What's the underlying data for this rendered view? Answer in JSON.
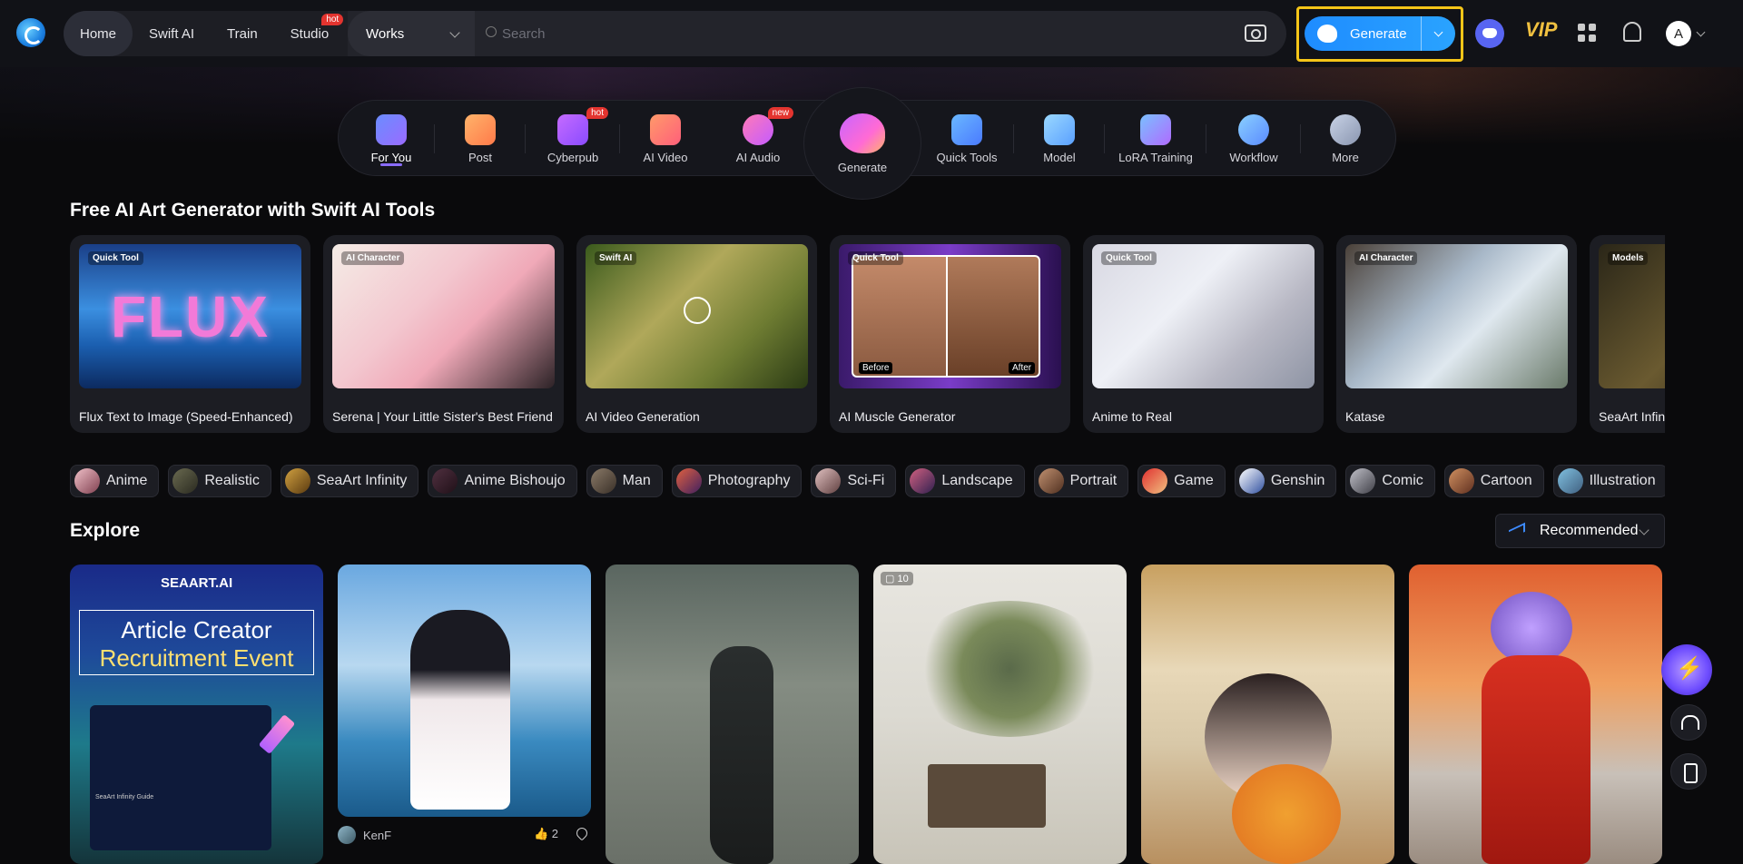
{
  "nav": {
    "items": [
      "Home",
      "Swift AI",
      "Train",
      "Studio"
    ],
    "studio_badge": "hot"
  },
  "search": {
    "scope": "Works",
    "placeholder": "Search"
  },
  "generate": {
    "label": "Generate"
  },
  "user": {
    "initial": "A"
  },
  "vip_label": "VIP",
  "categories": [
    {
      "label": "For You",
      "icon": "star-icon"
    },
    {
      "label": "Post",
      "icon": "post-icon"
    },
    {
      "label": "Cyberpub",
      "icon": "chat-icon",
      "badge": "hot"
    },
    {
      "label": "AI Video",
      "icon": "play-icon"
    },
    {
      "label": "AI Audio",
      "icon": "audio-icon",
      "badge": "new"
    },
    {
      "label": "Generate",
      "icon": "palette-icon"
    },
    {
      "label": "Quick Tools",
      "icon": "shield-ai-icon"
    },
    {
      "label": "Model",
      "icon": "cube-icon"
    },
    {
      "label": "LoRA Training",
      "icon": "lora-icon"
    },
    {
      "label": "Workflow",
      "icon": "workflow-icon"
    },
    {
      "label": "More",
      "icon": "more-icon"
    }
  ],
  "tools_title": "Free AI Art Generator with Swift AI Tools",
  "tools": [
    {
      "tag": "Quick Tool",
      "name": "Flux Text to Image (Speed-Enhanced)",
      "overlay": "FLUX"
    },
    {
      "tag": "AI Character",
      "name": "Serena | Your Little Sister's Best Friend"
    },
    {
      "tag": "Swift AI",
      "name": "AI Video Generation"
    },
    {
      "tag": "Quick Tool",
      "name": "AI Muscle Generator",
      "before": "Before",
      "after": "After"
    },
    {
      "tag": "Quick Tool",
      "name": "Anime to Real"
    },
    {
      "tag": "AI Character",
      "name": "Katase"
    },
    {
      "tag": "Models",
      "name": "SeaArt Infinity"
    }
  ],
  "chips": [
    "Anime",
    "Realistic",
    "SeaArt Infinity",
    "Anime Bishoujo",
    "Man",
    "Photography",
    "Sci-Fi",
    "Landscape",
    "Portrait",
    "Game",
    "Genshin",
    "Comic",
    "Cartoon",
    "Illustration"
  ],
  "explore": {
    "title": "Explore",
    "sort": "Recommended"
  },
  "feed": {
    "event_brand": "SEAART.AI",
    "event_line1": "Article Creator",
    "event_line2": "Recruitment Event",
    "event_doc_title": "SeaArt Infinity Guide",
    "card2_author": "KenF",
    "card2_likes": "2",
    "card4_count": "10"
  },
  "colors": {
    "accent": "#1e8cff",
    "highlight": "#f5c518",
    "hot_badge": "#e3342f"
  }
}
